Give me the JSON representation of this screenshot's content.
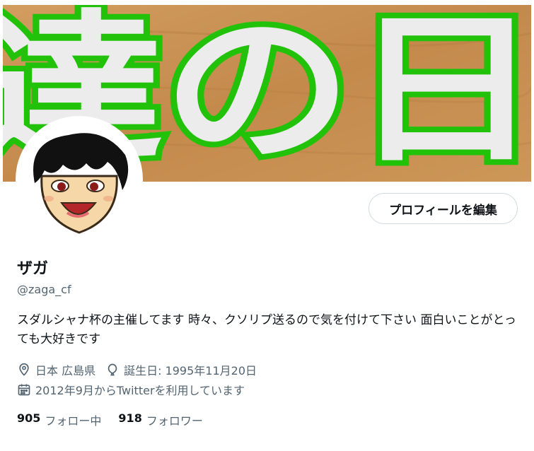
{
  "profile": {
    "name": "ザガ",
    "handle": "@zaga_cf",
    "bio": "スダルシャナ杯の主催してます 時々、クソリプ送るので気を付けて下さい 面白いことがとっても大好きです",
    "location": "日本 広島県",
    "birthday": "誕生日: 1995年11月20日",
    "joined": "2012年9月からTwitterを利用しています",
    "edit_label": "プロフィールを編集"
  },
  "banner": {
    "text": "達の日"
  },
  "stats": {
    "following_count": "905",
    "following_label": "フォロー中",
    "followers_count": "918",
    "followers_label": "フォロワー"
  },
  "icons": {
    "location": "location-pin-icon",
    "birthday": "balloon-icon",
    "joined": "calendar-icon"
  },
  "colors": {
    "banner_wood": "#c99356",
    "banner_outline": "#22c20a",
    "text_primary": "#0f1419",
    "text_secondary": "#536471",
    "button_border": "#cfd9de"
  }
}
